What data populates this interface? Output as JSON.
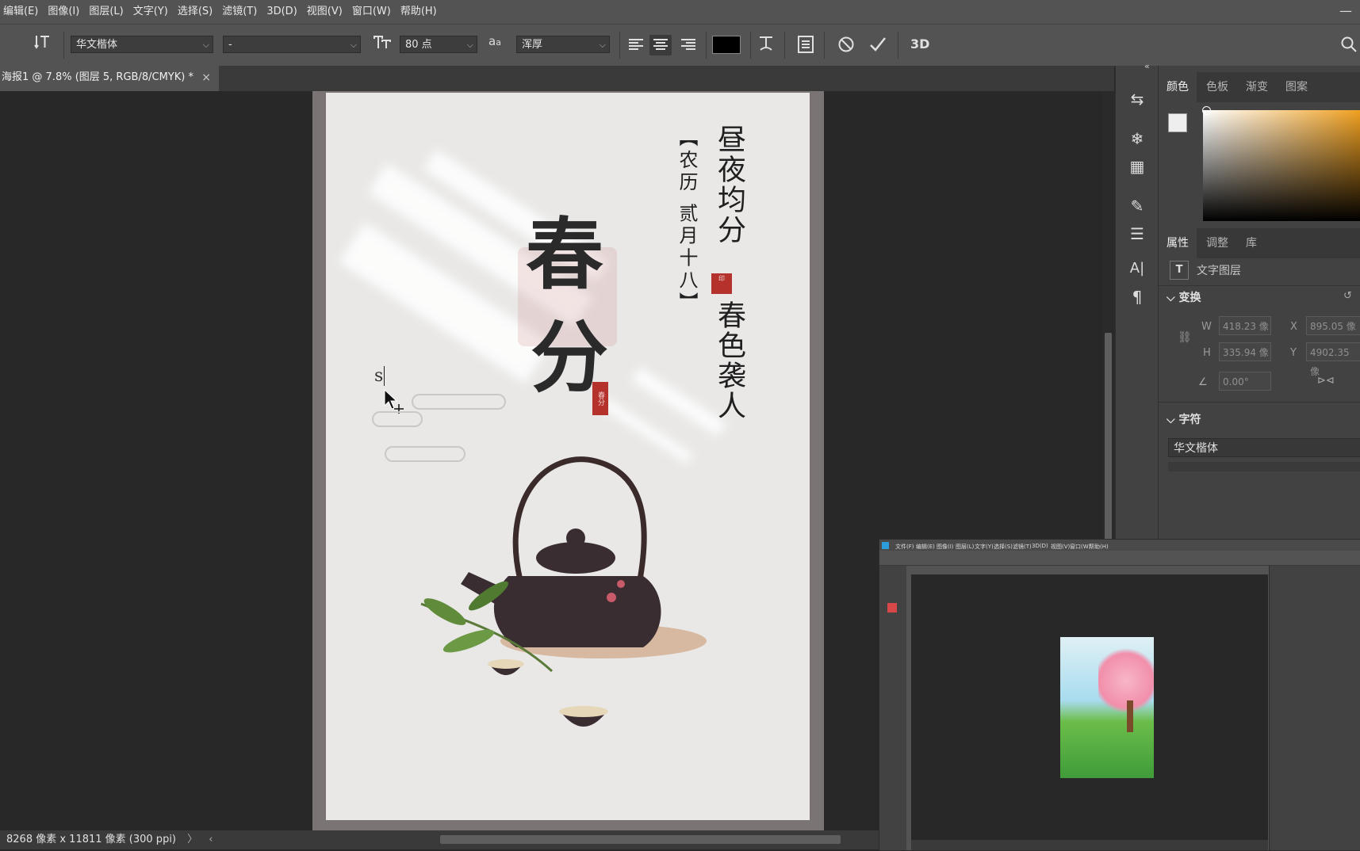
{
  "menu": [
    "编辑(E)",
    "图像(I)",
    "图层(L)",
    "文字(Y)",
    "选择(S)",
    "滤镜(T)",
    "3D(D)",
    "视图(V)",
    "窗口(W)",
    "帮助(H)"
  ],
  "options": {
    "font_family": "华文楷体",
    "font_style": "-",
    "font_size": "80 点",
    "aa_label": "a",
    "antialias": "浑厚",
    "color_swatch": "#000000",
    "threed_label": "3D"
  },
  "document_tab": {
    "title": "海报1 @ 7.8% (图层 5, RGB/8/CMYK) *",
    "close": "×"
  },
  "status": {
    "text": "8268 像素 x 11811 像素 (300 ppi)"
  },
  "poster": {
    "title_chars": [
      "春",
      "分"
    ],
    "seal_small": "春分",
    "vertical_date": "【农历 贰月十八】",
    "vertical_line1": "昼夜均分",
    "vertical_line2": "春色袭人",
    "typed_text": "s"
  },
  "color_panel": {
    "tabs": [
      "颜色",
      "色板",
      "渐变",
      "图案"
    ]
  },
  "properties_panel": {
    "tabs": [
      "属性",
      "调整",
      "库"
    ],
    "layer_type": "文字图层",
    "transform_title": "变换",
    "w_label": "W",
    "w_value": "418.23 像",
    "x_label": "X",
    "x_value": "895.05 像",
    "h_label": "H",
    "h_value": "335.94 像",
    "y_label": "Y",
    "y_value": "4902.35 像",
    "angle_value": "0.00°",
    "char_title": "字符",
    "char_font": "华文楷体"
  },
  "second_window": {
    "menu": [
      "文件(F)",
      "编辑(E)",
      "图像(I)",
      "图层(L)",
      "文字(Y)",
      "选择(S)",
      "滤镜(T)",
      "3D(D)",
      "视图(V)",
      "窗口(W)",
      "帮助(H)"
    ]
  },
  "colors": {
    "accent": "#b5312b",
    "ui_bg": "#535353",
    "canvas_bg": "#282828"
  }
}
